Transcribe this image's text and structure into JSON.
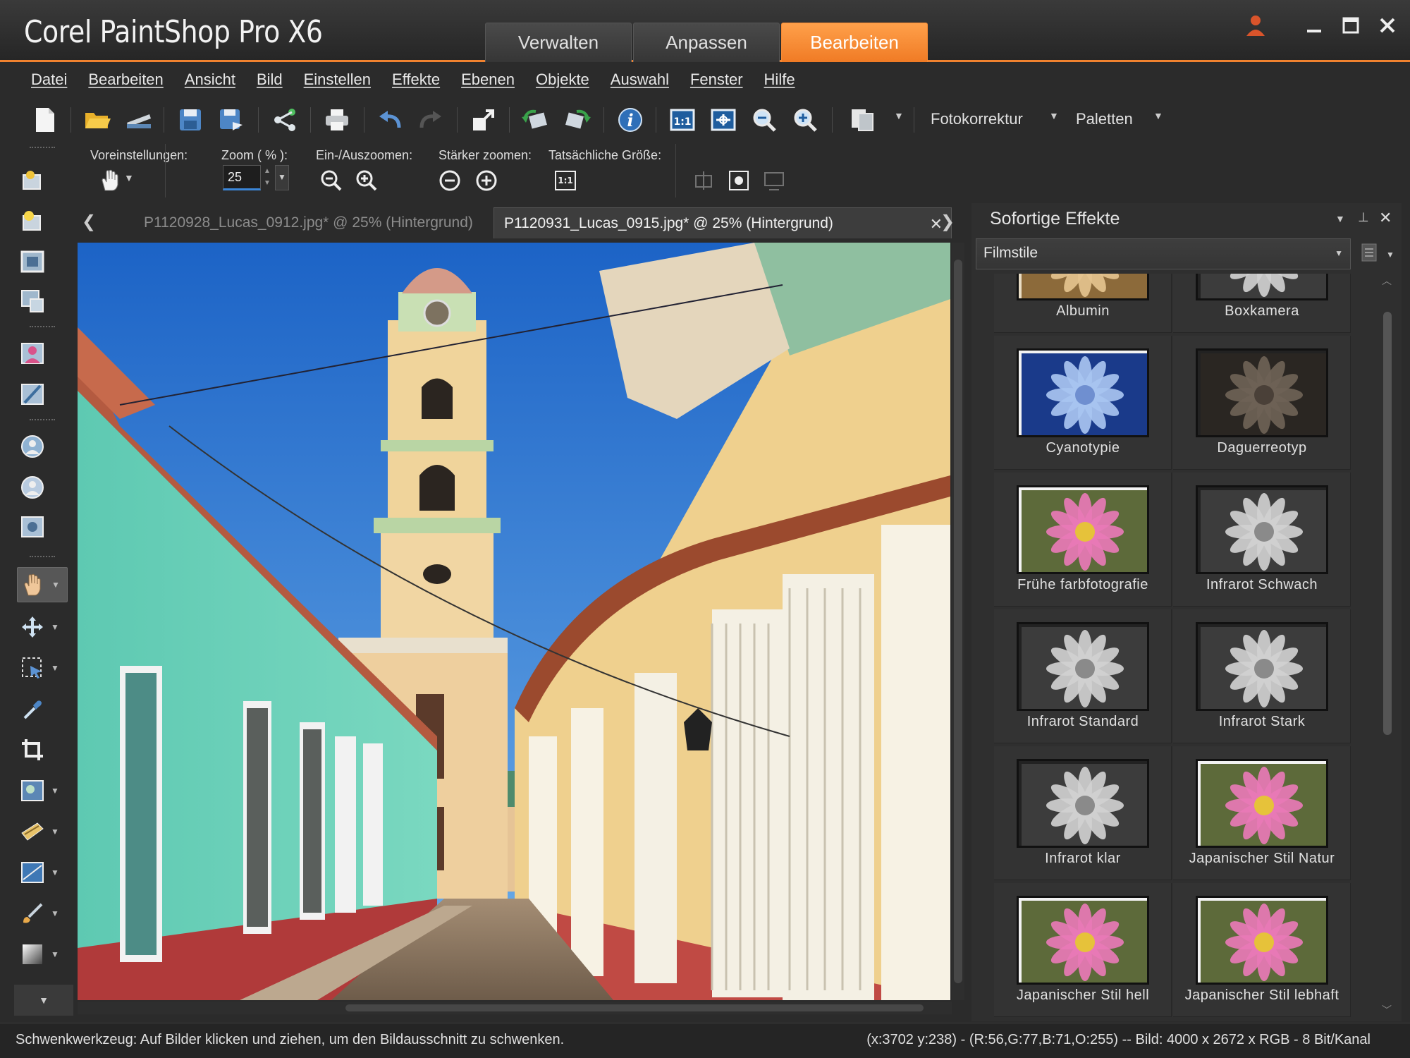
{
  "app": {
    "title": "Corel PaintShop Pro X6"
  },
  "modes": [
    {
      "label": "Verwalten",
      "active": false
    },
    {
      "label": "Anpassen",
      "active": false
    },
    {
      "label": "Bearbeiten",
      "active": true
    }
  ],
  "menu": [
    "Datei",
    "Bearbeiten",
    "Ansicht",
    "Bild",
    "Einstellen",
    "Effekte",
    "Ebenen",
    "Objekte",
    "Auswahl",
    "Fenster",
    "Hilfe"
  ],
  "toolbar": {
    "photo_fix": "Fotokorrektur",
    "palettes": "Paletten"
  },
  "options": {
    "presets_label": "Voreinstellungen:",
    "zoom_label": "Zoom ( % ):",
    "zoom_value": "25",
    "zoom_inout_label": "Ein-/Auszoomen:",
    "zoom_more_label": "Stärker zoomen:",
    "actual_size_label": "Tatsächliche Größe:",
    "actual_size_icon_text": "1:1"
  },
  "documents": [
    {
      "label": "P1120928_Lucas_0912.jpg* @  25% (Hintergrund)",
      "active": false
    },
    {
      "label": "P1120931_Lucas_0915.jpg* @  25% (Hintergrund)",
      "active": true
    }
  ],
  "effects_panel": {
    "title": "Sofortige Effekte",
    "category": "Filmstile",
    "items": [
      {
        "label": "Albumin",
        "style": "albumin"
      },
      {
        "label": "Boxkamera",
        "style": "boxcam"
      },
      {
        "label": "Cyanotypie",
        "style": "cyano"
      },
      {
        "label": "Daguerreotyp",
        "style": "dague"
      },
      {
        "label": "Frühe farbfotografie",
        "style": "early"
      },
      {
        "label": "Infrarot Schwach",
        "style": "ir"
      },
      {
        "label": "Infrarot Standard",
        "style": "ir"
      },
      {
        "label": "Infrarot Stark",
        "style": "ir"
      },
      {
        "label": "Infrarot klar",
        "style": "ir"
      },
      {
        "label": "Japanischer Stil Natur",
        "style": "jap"
      },
      {
        "label": "Japanischer Stil hell",
        "style": "jap"
      },
      {
        "label": "Japanischer Stil lebhaft",
        "style": "jap"
      }
    ]
  },
  "status": {
    "hint": "Schwenkwerkzeug: Auf Bilder klicken und ziehen, um den Bildausschnitt zu schwenken.",
    "info": "(x:3702 y:238) - (R:56,G:77,B:71,O:255) -- Bild:  4000 x 2672 x RGB - 8 Bit/Kanal"
  },
  "colors": {
    "accent": "#f0822f",
    "background": "#2b2b2b"
  }
}
